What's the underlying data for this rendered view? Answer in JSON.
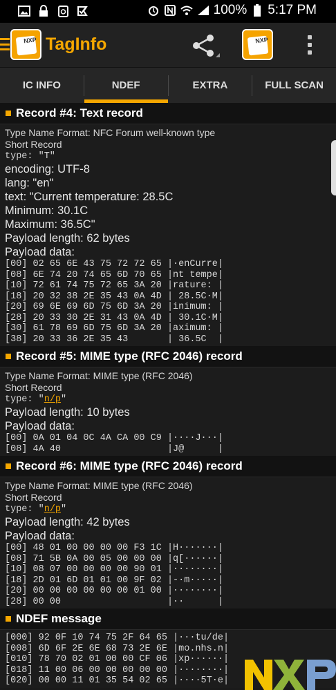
{
  "statusbar": {
    "left_icons": [
      "image-icon",
      "lock-icon",
      "clipboard-icon",
      "check-flag-icon"
    ],
    "battery_percent": "100%",
    "time": "5:17 PM"
  },
  "toolbar": {
    "title": "TagInfo",
    "logo_text": "NXP"
  },
  "tabs": [
    {
      "label": "IC INFO"
    },
    {
      "label": "NDEF"
    },
    {
      "label": "EXTRA"
    },
    {
      "label": "FULL SCAN"
    }
  ],
  "active_tab": "NDEF",
  "record4": {
    "heading": "Record #4: Text record",
    "tnf": "Type Name Format: NFC Forum well-known type",
    "short_record": "Short Record",
    "type_line": "type: \"T\"",
    "encoding": "encoding: UTF-8",
    "lang": "lang: \"en\"",
    "text_line1": "text: \"Current temperature:  28.5C",
    "text_line2": "Minimum:  30.1C",
    "text_line3": "Maximum:  36.5C\"",
    "payload_length": "Payload length: 62 bytes",
    "payload_data_label": "Payload data:",
    "hex": [
      "[00] 02 65 6E 43 75 72 72 65 |·enCurre|",
      "[08] 6E 74 20 74 65 6D 70 65 |nt tempe|",
      "[10] 72 61 74 75 72 65 3A 20 |rature: |",
      "[18] 20 32 38 2E 35 43 0A 4D | 28.5C·M|",
      "[20] 69 6E 69 6D 75 6D 3A 20 |inimum: |",
      "[28] 20 33 30 2E 31 43 0A 4D | 30.1C·M|",
      "[30] 61 78 69 6D 75 6D 3A 20 |aximum: |",
      "[38] 20 33 36 2E 35 43       | 36.5C  |"
    ]
  },
  "record5": {
    "heading": "Record #5: MIME type (RFC 2046) record",
    "tnf": "Type Name Format: MIME type (RFC 2046)",
    "short_record": "Short Record",
    "type_prefix": "type: \"",
    "type_value": "n/p",
    "type_suffix": "\"",
    "payload_length": "Payload length: 10 bytes",
    "payload_data_label": "Payload data:",
    "hex": [
      "[00] 0A 01 04 0C 4A CA 00 C9 |····J···|",
      "[08] 4A 40                   |J@      |"
    ]
  },
  "record6": {
    "heading": "Record #6: MIME type (RFC 2046) record",
    "tnf": "Type Name Format: MIME type (RFC 2046)",
    "short_record": "Short Record",
    "type_prefix": "type: \"",
    "type_value": "n/p",
    "type_suffix": "\"",
    "payload_length": "Payload length: 42 bytes",
    "payload_data_label": "Payload data:",
    "hex": [
      "[00] 48 01 00 00 00 00 F3 1C |H·······|",
      "[08] 71 5B 0A 00 05 00 00 00 |q[······|",
      "[10] 08 07 00 00 00 00 90 01 |········|",
      "[18] 2D 01 6D 01 01 00 9F 02 |-·m·····|",
      "[20] 00 00 00 00 00 00 01 00 |········|",
      "[28] 00 00                   |··      |"
    ]
  },
  "ndef_message": {
    "heading": "NDEF message",
    "hex": [
      "[000] 92 0F 10 74 75 2F 64 65 |···tu/de|",
      "[008] 6D 6F 2E 6E 68 73 2E 6E |mo.nhs.n|",
      "[010] 78 70 02 01 00 00 CF 06 |xp······|",
      "[018] 11 00 06 00 00 00 00 00 |········|",
      "[020] 00 00 11 01 35 54 02 65 |····5T·e|"
    ]
  },
  "watermark": "NXP",
  "colors": {
    "accent": "#f5a700",
    "background": "#1a1a1a",
    "header_bg": "#121212"
  }
}
